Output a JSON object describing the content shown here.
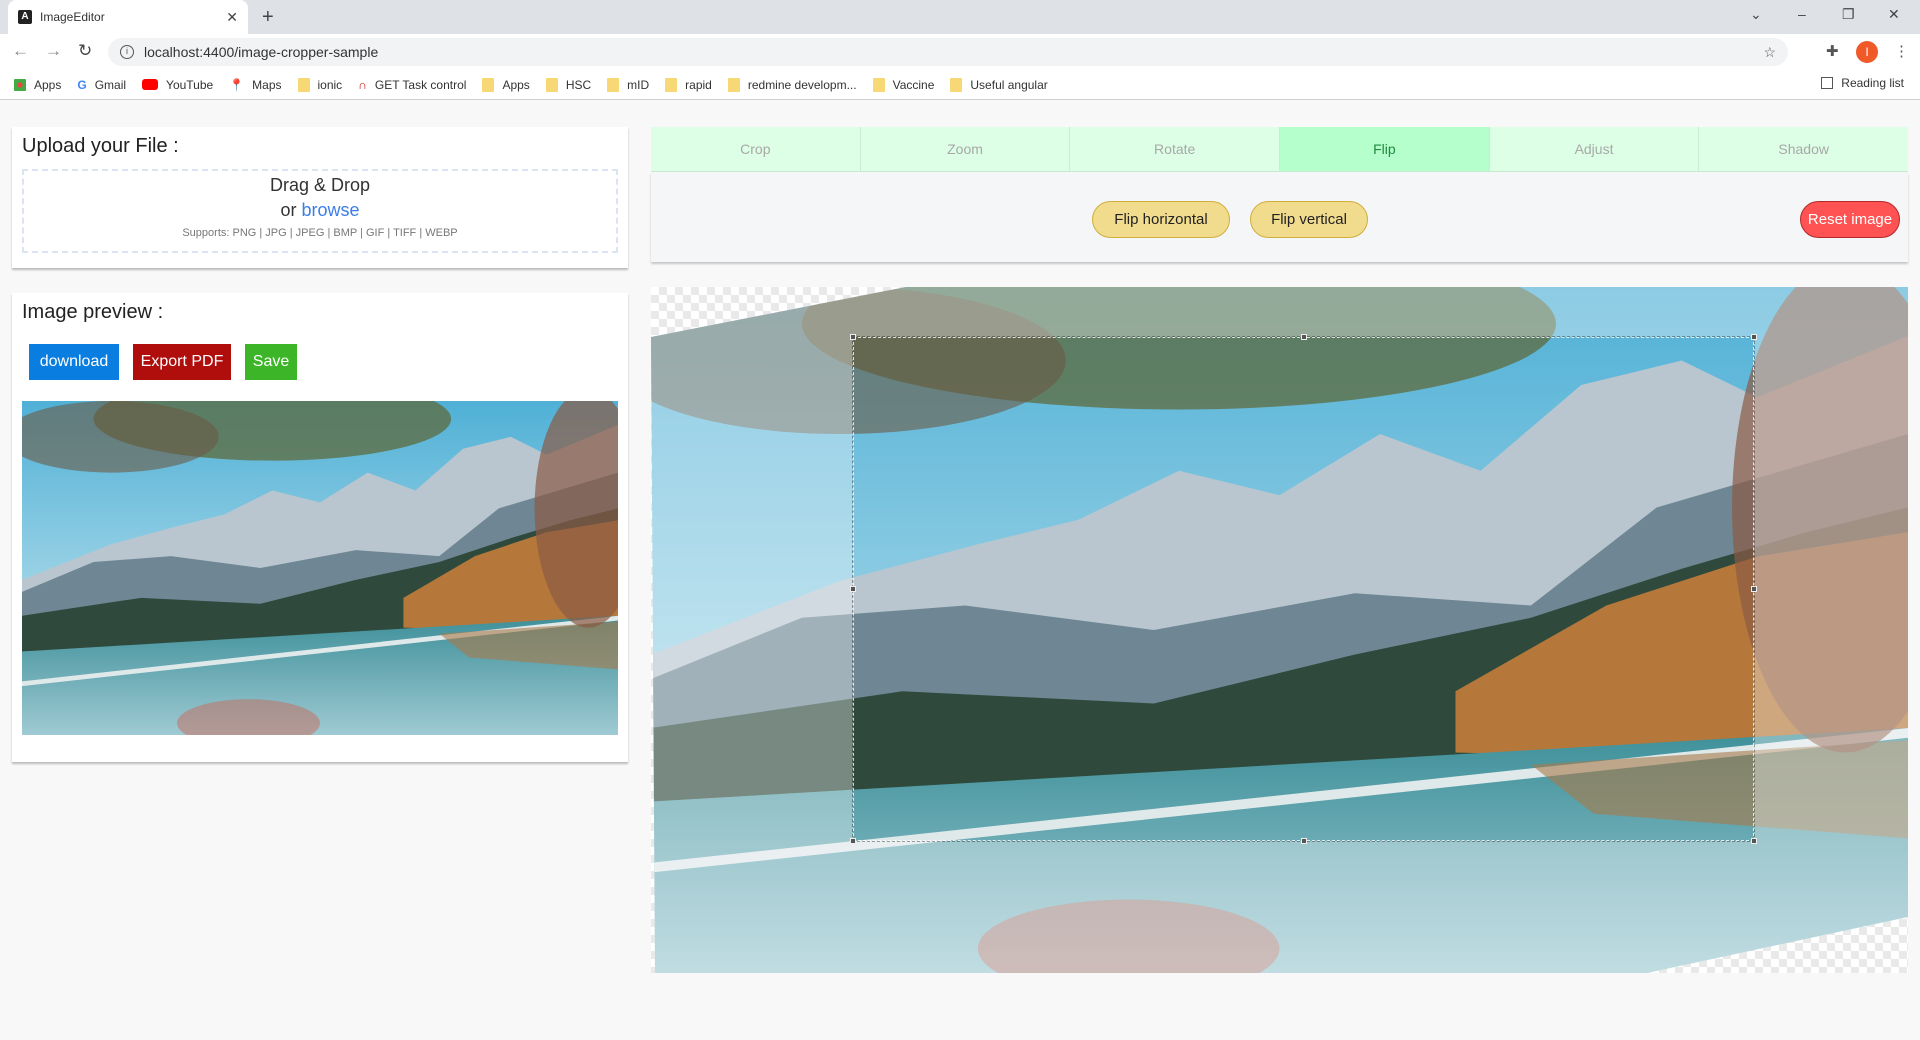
{
  "browser": {
    "tab_title": "ImageEditor",
    "url": "localhost:4400/image-cropper-sample",
    "profile_initial": "I",
    "bookmarks": [
      "Apps",
      "Gmail",
      "YouTube",
      "Maps",
      "ionic",
      "GET Task control",
      "Apps",
      "HSC",
      "mID",
      "rapid",
      "redmine developm...",
      "Vaccine",
      "Useful angular"
    ],
    "reading_list": "Reading list"
  },
  "upload": {
    "title": "Upload your File :",
    "drag_drop": "Drag & Drop",
    "or": "or",
    "browse": "browse",
    "supports": "Supports: PNG | JPG | JPEG | BMP | GIF | TIFF | WEBP"
  },
  "preview": {
    "title": "Image preview :",
    "download": "download",
    "export_pdf": "Export PDF",
    "save": "Save"
  },
  "editor": {
    "tabs": [
      "Crop",
      "Zoom",
      "Rotate",
      "Flip",
      "Adjust",
      "Shadow"
    ],
    "active_tab": "Flip",
    "flip_horizontal": "Flip horizontal",
    "flip_vertical": "Flip vertical",
    "reset": "Reset image"
  },
  "colors": {
    "download": "#0a7ee0",
    "export_pdf": "#b00d0d",
    "save": "#3db529",
    "browse": "#3a7ee8",
    "reset": "#ff5252",
    "active_tab": "#b5ffcc"
  }
}
